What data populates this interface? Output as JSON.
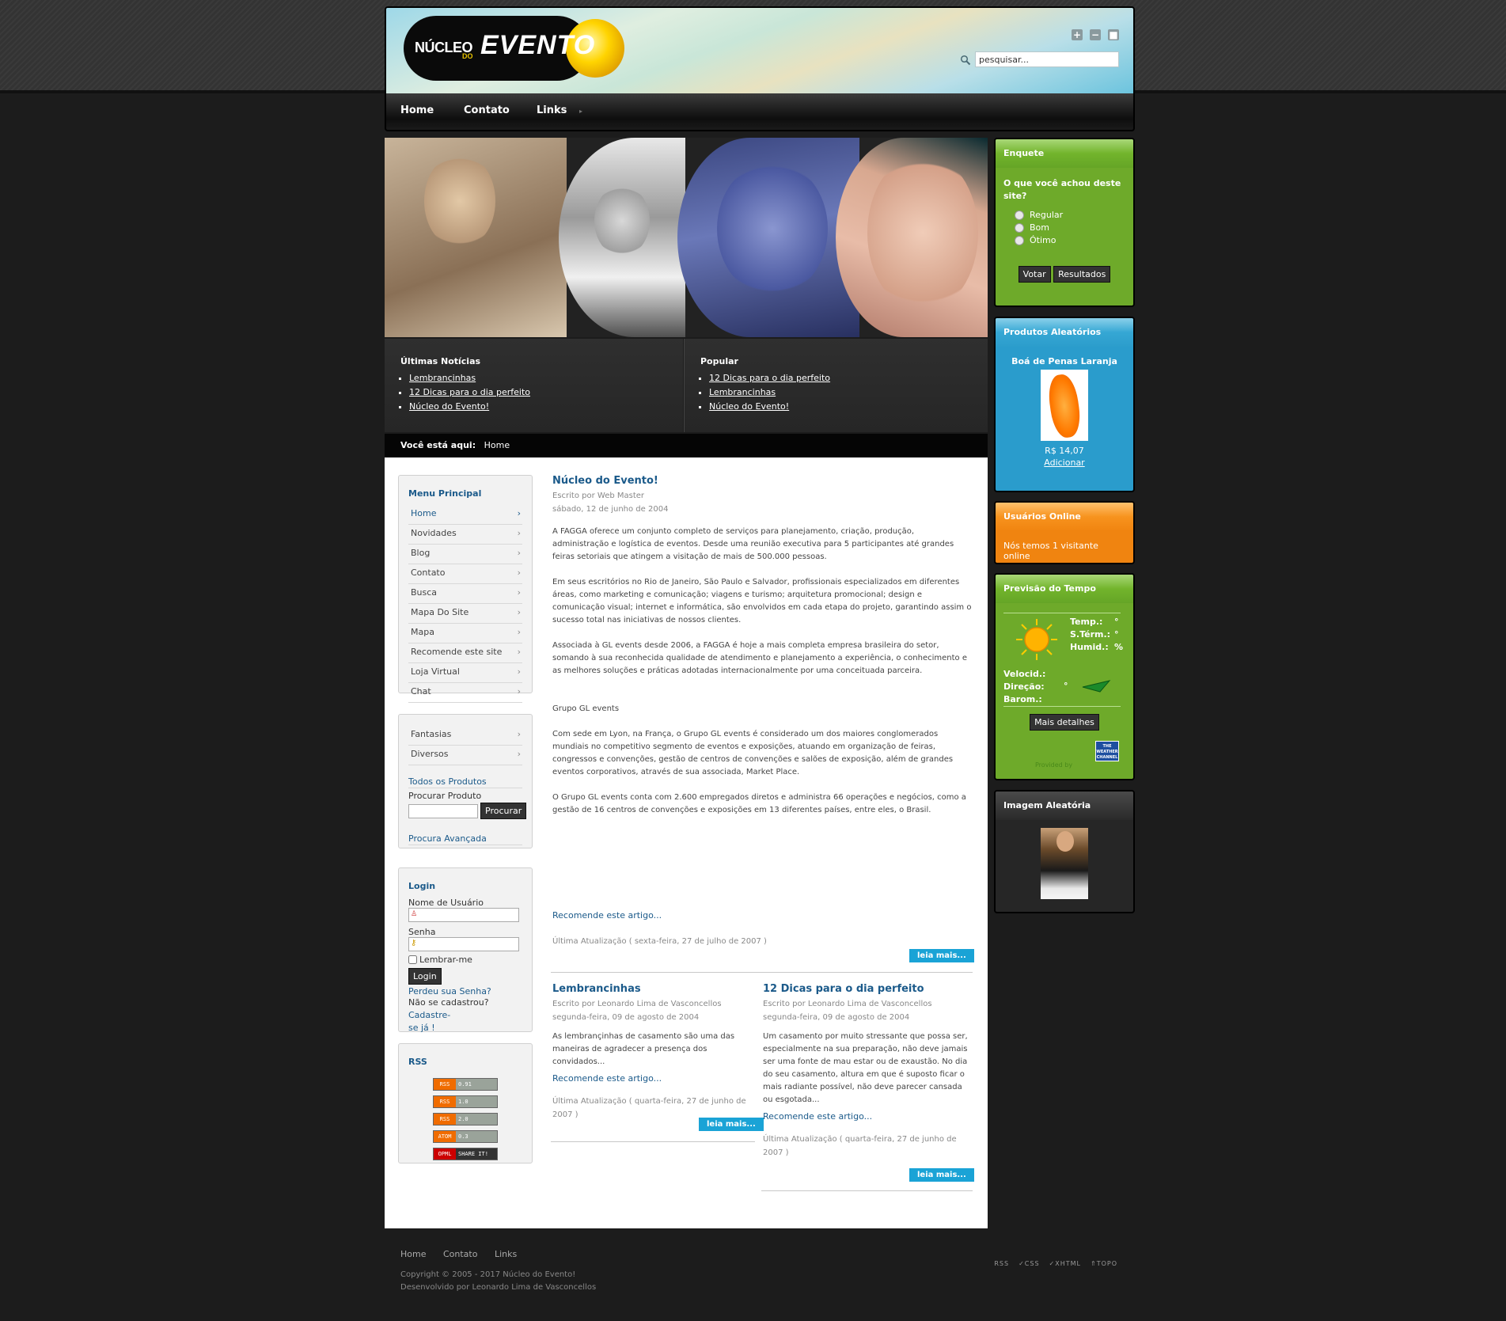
{
  "header": {
    "logo_text_1": "NÚCLEO",
    "logo_text_2": "DO",
    "logo_text_3": "EVENTO",
    "font_buttons": [
      "+",
      "−",
      "■"
    ],
    "search_placeholder": "pesquisar..."
  },
  "nav": {
    "items": [
      "Home",
      "Contato",
      "Links"
    ]
  },
  "latest_news": {
    "title": "Últimas Notícias",
    "items": [
      "Lembrancinhas",
      "12 Dicas para o dia perfeito",
      "Núcleo do Evento!"
    ]
  },
  "popular": {
    "title": "Popular",
    "items": [
      "12 Dicas para o dia perfeito",
      "Lembrancinhas",
      "Núcleo do Evento!"
    ]
  },
  "breadcrumb": {
    "label": "Você está aqui:",
    "current": "Home"
  },
  "main_menu": {
    "title": "Menu Principal",
    "items": [
      "Home",
      "Novidades",
      "Blog",
      "Contato",
      "Busca",
      "Mapa Do Site",
      "Mapa",
      "Recomende este site",
      "Loja Virtual",
      "Chat"
    ]
  },
  "shop_menu": {
    "items": [
      "Fantasias",
      "Diversos"
    ],
    "all_products": "Todos os Produtos",
    "search_label": "Procurar Produto",
    "search_button": "Procurar",
    "advanced": "Procura Avançada"
  },
  "login": {
    "title": "Login",
    "username_label": "Nome de Usuário",
    "password_label": "Senha",
    "remember": "Lembrar-me",
    "button": "Login",
    "lost_password": "Perdeu sua Senha?",
    "not_registered": "Não se cadastrou?",
    "register_link_1": "Cadastre-",
    "register_link_2": "se já !"
  },
  "rss": {
    "title": "RSS",
    "badges": [
      {
        "left": "RSS",
        "right": "0.91"
      },
      {
        "left": "RSS",
        "right": "1.0"
      },
      {
        "left": "RSS",
        "right": "2.0"
      },
      {
        "left": "ATOM",
        "right": "0.3"
      },
      {
        "left": "OPML",
        "right": "SHARE IT!"
      }
    ]
  },
  "article": {
    "title": "Núcleo do Evento!",
    "author": "Escrito por Web Master",
    "date": "sábado, 12 de junho de 2004",
    "paragraphs": [
      "A FAGGA oferece um conjunto completo de serviços para planejamento, criação, produção, administração e logística de eventos. Desde uma reunião executiva para 5 participantes até grandes feiras setoriais que atingem a visitação de mais de 500.000 pessoas.",
      "Em seus escritórios no Rio de Janeiro, São Paulo e Salvador, profissionais especializados em diferentes áreas, como marketing e comunicação; viagens e turismo; arquitetura promocional; design e comunicação visual; internet e informática, são envolvidos em cada etapa do projeto, garantindo assim o sucesso total nas iniciativas de nossos clientes.",
      "Associada à GL events desde 2006, a FAGGA é hoje a mais completa empresa brasileira do setor, somando à sua reconhecida qualidade de atendimento e planejamento a experiência, o conhecimento e as melhores soluções e práticas adotadas internacionalmente por uma conceituada parceira.",
      "Grupo GL events",
      "Com sede em Lyon, na França, o Grupo GL events é considerado um dos maiores conglomerados mundiais no competitivo segmento de eventos e exposições, atuando em organização de feiras, congressos e convenções, gestão de centros de convenções e salões de exposição, além de grandes eventos corporativos, através de sua associada, Market Place.",
      "O Grupo GL events conta com 2.600 empregados diretos e administra 66 operações e negócios, como a gestão de 16 centros de convenções e exposições em 13 diferentes países, entre eles, o Brasil."
    ],
    "recommend": "Recomende este artigo...",
    "updated": "Última Atualização ( sexta-feira, 27 de julho de 2007 )",
    "read_more": "leia mais..."
  },
  "article2": {
    "title": "Lembrancinhas",
    "author": "Escrito por Leonardo Lima de Vasconcellos",
    "date": "segunda-feira, 09 de agosto de 2004",
    "text": "As lembrançinhas de casamento são uma das maneiras de agradecer a presença dos convidados...",
    "recommend": "Recomende este artigo...",
    "updated": "Última Atualização ( quarta-feira, 27 de junho de 2007 )",
    "read_more": "leia mais..."
  },
  "article3": {
    "title": "12 Dicas para o dia perfeito",
    "author": "Escrito por Leonardo Lima de Vasconcellos",
    "date": "segunda-feira, 09 de agosto de 2004",
    "text": "Um casamento por muito stressante que possa ser, especialmente na sua preparação, não deve jamais ser uma fonte de mau estar ou de exaustão. No dia do seu casamento, altura em que é suposto ficar o mais radiante possível, não deve parecer cansada ou esgotada...",
    "recommend": "Recomende este artigo...",
    "updated": "Última Atualização ( quarta-feira, 27 de junho de 2007 )",
    "read_more": "leia mais..."
  },
  "poll": {
    "title": "Enquete",
    "question": "O que você achou deste site?",
    "options": [
      "Regular",
      "Bom",
      "Ótimo"
    ],
    "vote": "Votar",
    "results": "Resultados"
  },
  "random_products": {
    "title": "Produtos Aleatórios",
    "product_name": "Boá de Penas Laranja",
    "price": "R$ 14,07",
    "add": "Adicionar"
  },
  "online_users": {
    "title": "Usuários Online",
    "text": "Nós temos 1 visitante online"
  },
  "weather": {
    "title": "Previsão do Tempo",
    "temp_label": "Temp.:",
    "temp_value": "°",
    "feel_label": "S.Térm.:",
    "feel_value": "°",
    "humid_label": "Humid.:",
    "humid_value": "%",
    "wind_label": "Velocid.:",
    "dir_label": "Direção:",
    "dir_value": "°",
    "baro_label": "Barom.:",
    "more": "Mais detalhes",
    "provider": "THE WEATHER CHANNEL",
    "provided_by": "Provided by"
  },
  "random_image": {
    "title": "Imagem Aleatória"
  },
  "footer": {
    "links": [
      "Home",
      "Contato",
      "Links"
    ],
    "copyright": "Copyright © 2005 - 2017 Núcleo do Evento!",
    "developed_label": "Desenvolvido por",
    "developer": "Leonardo Lima de Vasconcellos",
    "icons": [
      "RSS",
      "CSS",
      "XHTML",
      "TOPO"
    ]
  },
  "colors": {
    "accent_blue": "#1b5a8a",
    "read_more_blue": "#1aa3d6",
    "poll_green": "#6eaa2a",
    "products_blue": "#2a9ccc",
    "online_orange": "#f08410"
  }
}
